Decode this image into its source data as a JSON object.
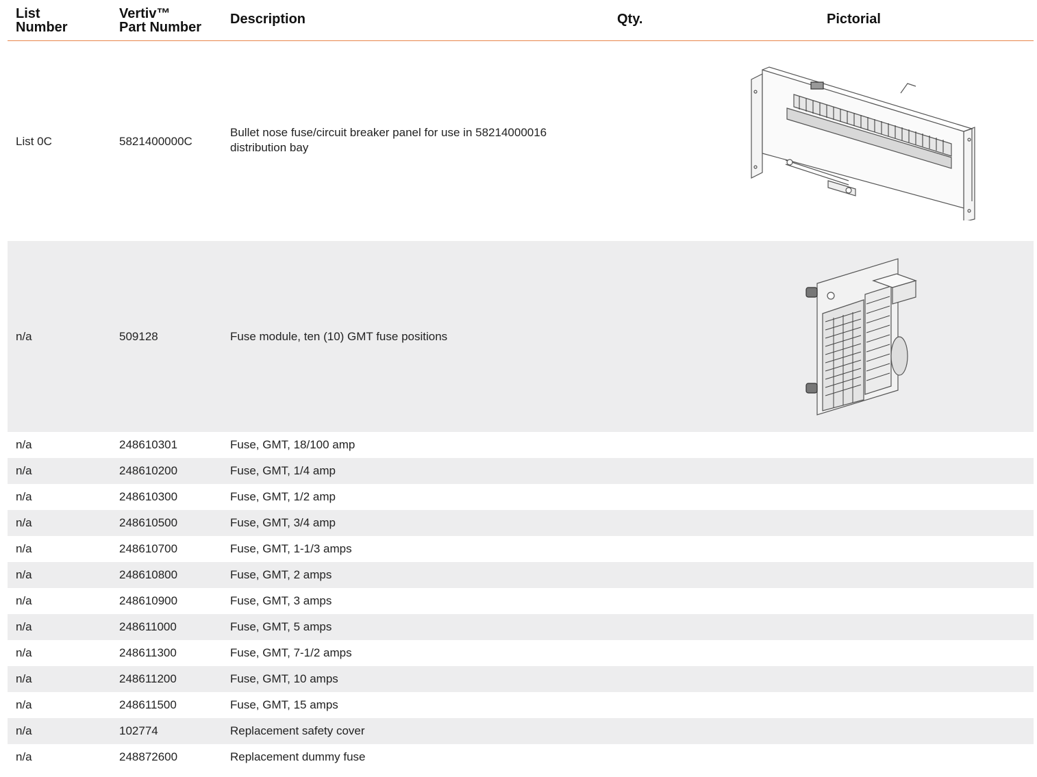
{
  "header": {
    "list_line1": "List",
    "list_line2": "Number",
    "part_line1": "Vertiv™",
    "part_line2": "Part Number",
    "description": "Description",
    "qty": "Qty.",
    "pictorial": "Pictorial"
  },
  "rows": [
    {
      "list": "List 0C",
      "part": "5821400000C",
      "desc": "Bullet nose fuse/circuit breaker panel for use in 58214000016 distribution bay",
      "qty": "",
      "pictorial": "circuit-breaker-panel-drawing"
    },
    {
      "list": "n/a",
      "part": "509128",
      "desc": "Fuse module, ten (10) GMT fuse positions",
      "qty": "",
      "pictorial": "fuse-module-drawing"
    },
    {
      "list": "n/a",
      "part": "248610301",
      "desc": "Fuse, GMT, 18/100 amp",
      "qty": ""
    },
    {
      "list": "n/a",
      "part": "248610200",
      "desc": "Fuse, GMT, 1/4 amp",
      "qty": ""
    },
    {
      "list": "n/a",
      "part": "248610300",
      "desc": "Fuse, GMT, 1/2 amp",
      "qty": ""
    },
    {
      "list": "n/a",
      "part": "248610500",
      "desc": "Fuse, GMT, 3/4 amp",
      "qty": ""
    },
    {
      "list": "n/a",
      "part": "248610700",
      "desc": "Fuse, GMT, 1-1/3 amps",
      "qty": ""
    },
    {
      "list": "n/a",
      "part": "248610800",
      "desc": "Fuse, GMT, 2 amps",
      "qty": ""
    },
    {
      "list": "n/a",
      "part": "248610900",
      "desc": "Fuse, GMT, 3 amps",
      "qty": ""
    },
    {
      "list": "n/a",
      "part": "248611000",
      "desc": "Fuse, GMT, 5 amps",
      "qty": ""
    },
    {
      "list": "n/a",
      "part": "248611300",
      "desc": "Fuse, GMT, 7-1/2 amps",
      "qty": ""
    },
    {
      "list": "n/a",
      "part": "248611200",
      "desc": "Fuse, GMT, 10 amps",
      "qty": ""
    },
    {
      "list": "n/a",
      "part": "248611500",
      "desc": "Fuse, GMT, 15 amps",
      "qty": ""
    },
    {
      "list": "n/a",
      "part": "102774",
      "desc": "Replacement safety cover",
      "qty": ""
    },
    {
      "list": "n/a",
      "part": "248872600",
      "desc": "Replacement dummy fuse",
      "qty": ""
    }
  ],
  "colors": {
    "header_rule": "#e8864a",
    "alt_row": "#ededee"
  }
}
